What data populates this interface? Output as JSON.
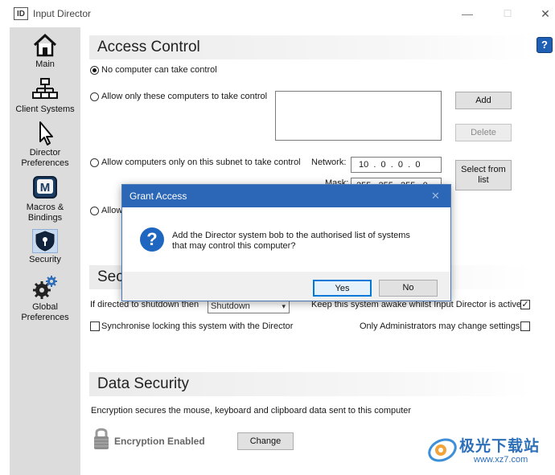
{
  "window": {
    "app_icon_text": "ID",
    "title": "Input Director",
    "minimize": "—",
    "maximize": "☐",
    "close": "✕"
  },
  "help_label": "?",
  "sidebar": {
    "items": [
      {
        "label": "Main"
      },
      {
        "label": "Client Systems"
      },
      {
        "label": "Director\nPreferences"
      },
      {
        "label": "Macros &\nBindings"
      },
      {
        "label": "Security"
      },
      {
        "label": "Global\nPreferences"
      }
    ],
    "macros_icon_letter": "M"
  },
  "access_control": {
    "heading": "Access Control",
    "option_none": "No computer can take control",
    "option_only": "Allow only these computers to take control",
    "option_subnet": "Allow computers only on this subnet to take control",
    "option_fourth": "Allow",
    "add_button": "Add",
    "delete_button": "Delete",
    "network_label": "Network:",
    "network_value": "10  .  0  .  0  .  0",
    "mask_label": "Mask:",
    "mask_value": "255 . 255 . 255 . 0",
    "select_from_list": "Select from list"
  },
  "security_section": {
    "heading_partial": "Sec",
    "shutdown_label": "If directed to shutdown then",
    "shutdown_value": "Shutdown",
    "keep_awake": "Keep this system awake whilst Input Director is active",
    "keep_awake_checked": true,
    "sync_lock": "Synchronise locking this system with the Director",
    "sync_lock_checked": false,
    "only_admins": "Only Administrators may change settings",
    "only_admins_checked": false
  },
  "data_security": {
    "heading": "Data Security",
    "description": "Encryption secures the mouse, keyboard and clipboard data sent to this computer",
    "status": "Encryption Enabled",
    "change_button": "Change"
  },
  "dialog": {
    "title": "Grant Access",
    "close": "✕",
    "message_line1": "Add the Director system bob to the authorised list of systems",
    "message_line2": "that may control this computer?",
    "yes": "Yes",
    "no": "No"
  },
  "watermark": {
    "text": "极光下载站",
    "url": "www.xz7.com"
  },
  "colors": {
    "dialog_title_bg": "#2b67b6",
    "sidebar_bg": "#dcdcdc",
    "help_bg": "#1f5fb4",
    "question_icon_bg": "#1f66c1"
  }
}
